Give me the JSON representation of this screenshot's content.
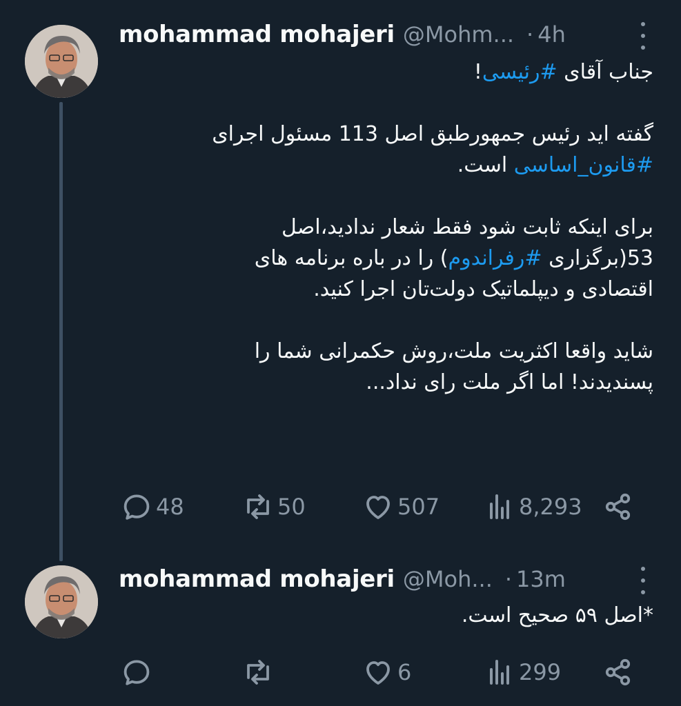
{
  "tweets": [
    {
      "name": "mohammad mohajeri",
      "handle": "@Mohm...",
      "dot": "·",
      "time": "4h",
      "lines": [
        [
          "جناب آقای ",
          {
            "tag": "#رئیسی"
          },
          "!"
        ],
        [],
        [
          "گفته اید رئیس جمهورطبق اصل 113 مسئول اجرای"
        ],
        [
          {
            "tag": "#قانون_اساسی"
          },
          " است."
        ],
        [],
        [
          "برای اینکه ثابت شود فقط شعار ندادید،اصل"
        ],
        [
          "53(برگزاری ",
          {
            "tag": "#رفراندوم"
          },
          ") را در باره برنامه های"
        ],
        [
          "اقتصادی و دیپلماتیک دولت‌تان اجرا کنید."
        ],
        [],
        [
          "شاید واقعا اکثریت ملت،روش حکمرانی شما را"
        ],
        [
          "پسندیدند! اما اگر ملت رای نداد..."
        ]
      ],
      "actions": {
        "replies": "48",
        "retweets": "50",
        "likes": "507",
        "views": "8,293"
      }
    },
    {
      "name": "mohammad mohajeri",
      "handle": "@Moh...",
      "dot": "·",
      "time": "13m",
      "lines": [
        [
          "*اصل ۵۹ صحیح است."
        ]
      ],
      "actions": {
        "replies": "",
        "retweets": "",
        "likes": "6",
        "views": "299"
      }
    }
  ],
  "icons": {
    "reply": "reply-icon",
    "retweet": "retweet-icon",
    "like": "heart-icon",
    "views": "views-icon",
    "share": "share-icon",
    "more": "more-icon"
  },
  "colors": {
    "background": "#15202b",
    "text": "#f7f9f9",
    "muted": "#8b98a5",
    "hashtag": "#1d9bf0",
    "thread_line": "#3e5063"
  }
}
